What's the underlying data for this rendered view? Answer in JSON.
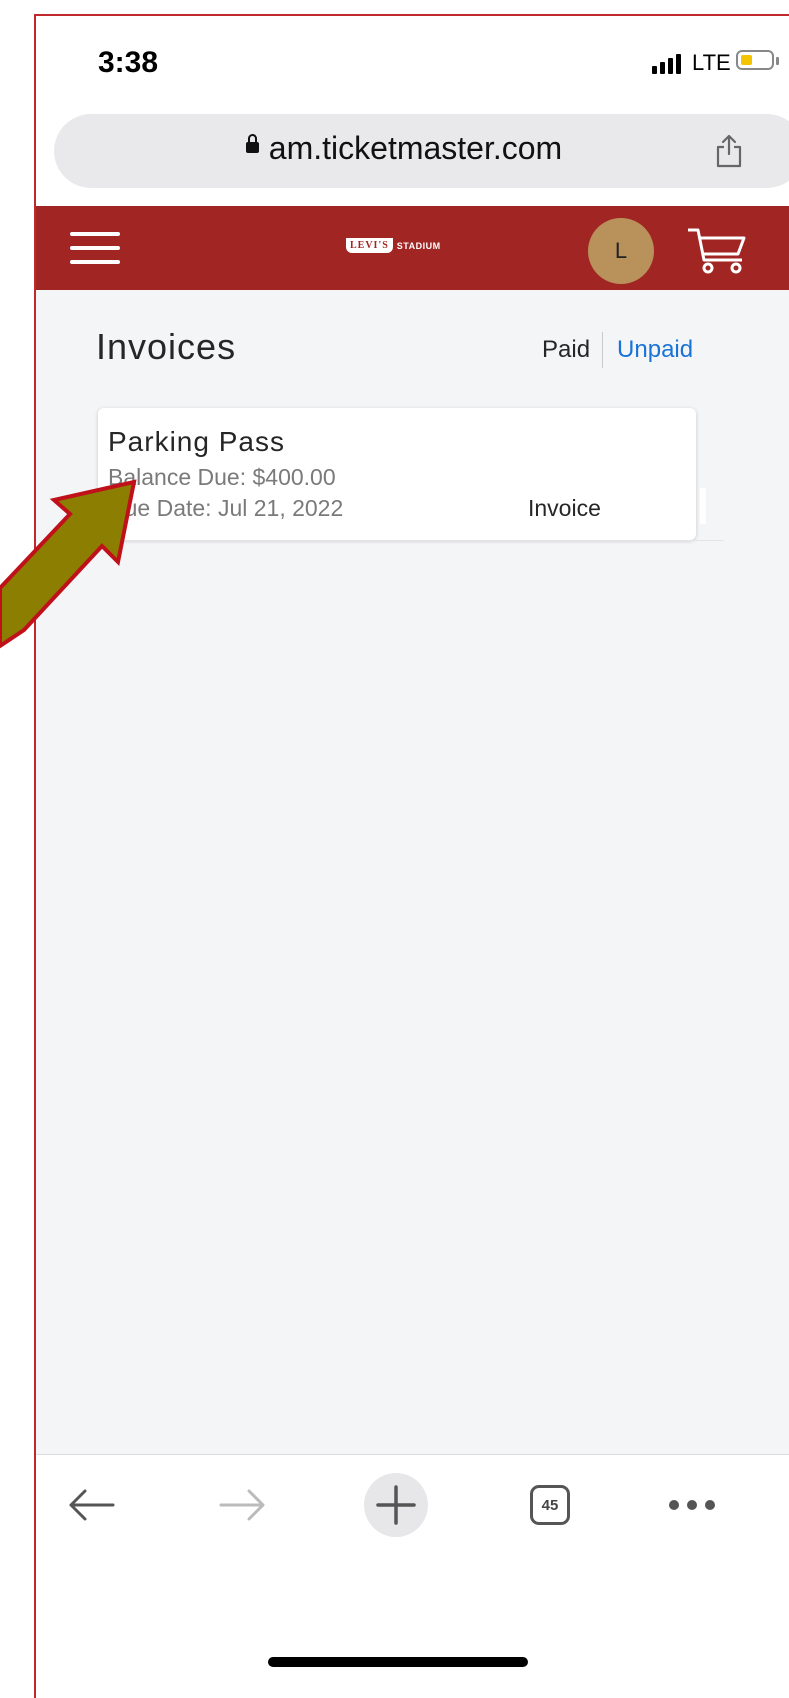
{
  "status_bar": {
    "time": "3:38",
    "network": "LTE"
  },
  "browser": {
    "url": "am.ticketmaster.com"
  },
  "header": {
    "logo_text": "LEVI'S",
    "logo_sub": "STADIUM",
    "avatar_initial": "L"
  },
  "page": {
    "title": "Invoices",
    "filters": {
      "paid": "Paid",
      "unpaid": "Unpaid"
    }
  },
  "invoice": {
    "name": "Parking Pass",
    "balance": "Balance Due: $400.00",
    "due": "Due Date: Jul 21, 2022",
    "link": "Invoice"
  },
  "toolbar": {
    "tab_count": "45"
  },
  "colors": {
    "brand": "#a02523",
    "link": "#1a73d6",
    "avatar": "#b9915a",
    "annotation_arrow": "#8b7e00"
  }
}
